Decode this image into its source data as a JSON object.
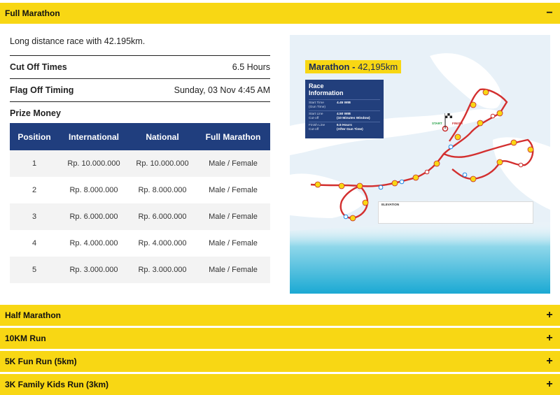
{
  "sections": [
    {
      "title": "Full Marathon",
      "sign": "−"
    },
    {
      "title": "Half Marathon",
      "sign": "+"
    },
    {
      "title": "10KM Run",
      "sign": "+"
    },
    {
      "title": "5K Fun Run (5km)",
      "sign": "+"
    },
    {
      "title": "3K Family Kids Run (3km)",
      "sign": "+"
    }
  ],
  "full_marathon": {
    "description": "Long distance race with 42.195km.",
    "cut_off": {
      "label": "Cut Off Times",
      "value": "6.5 Hours"
    },
    "flag_off": {
      "label": "Flag Off Timing",
      "value": "Sunday, 03 Nov 4:45 AM"
    },
    "prize_money_label": "Prize Money",
    "table": {
      "headers": [
        "Position",
        "International",
        "National",
        "Full Marathon"
      ],
      "rows": [
        [
          "1",
          "Rp. 10.000.000",
          "Rp. 10.000.000",
          "Male / Female"
        ],
        [
          "2",
          "Rp. 8.000.000",
          "Rp. 8.000.000",
          "Male / Female"
        ],
        [
          "3",
          "Rp. 6.000.000",
          "Rp. 6.000.000",
          "Male / Female"
        ],
        [
          "4",
          "Rp. 4.000.000",
          "Rp. 4.000.000",
          "Male / Female"
        ],
        [
          "5",
          "Rp. 3.000.000",
          "Rp. 3.000.000",
          "Male / Female"
        ]
      ]
    }
  },
  "map": {
    "title_word": "Marathon - ",
    "title_distance": "42,195km",
    "info_heading_1": "Race",
    "info_heading_2": "Information",
    "info_rows": [
      {
        "k1": "Start Time",
        "k2": "(Gun Time)",
        "v1": "4.45 WIB",
        "v2": ""
      },
      {
        "k1": "Start Line",
        "k2": "Cut-off",
        "v1": "4.50 WIB",
        "v2": "(10 Minutes Window)"
      },
      {
        "k1": "Finish Line",
        "k2": "Cut-off",
        "v1": "6.5 Hours",
        "v2": "(After Gun Time)"
      }
    ],
    "start_label": "START",
    "finish_label": "FINISH",
    "elevation_label": "ELEVATION",
    "colors": {
      "route": "#d32f2f",
      "sea": "#29b6d8",
      "land": "#ffffff",
      "water": "#e8f1f8",
      "navy": "#223f7c",
      "yellow": "#f8d714"
    }
  }
}
